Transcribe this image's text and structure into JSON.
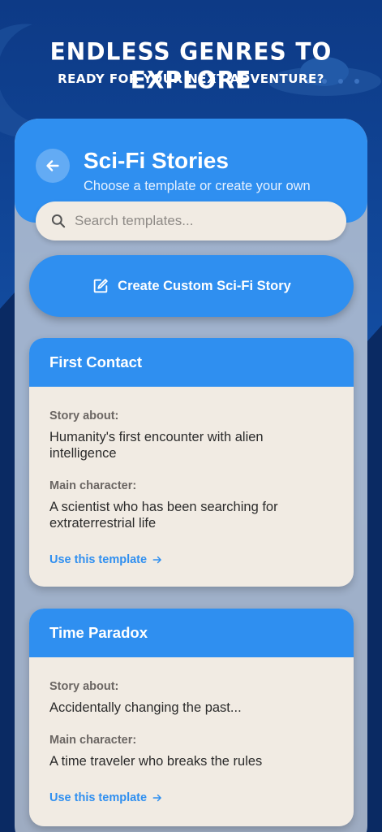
{
  "promo": {
    "headline": "Endless Genres to Explore",
    "subline": "Ready for your next adventure?"
  },
  "header": {
    "title": "Sci-Fi Stories",
    "subtitle": "Choose a template or create your own",
    "back_icon": "arrow-left-icon"
  },
  "search": {
    "placeholder": "Search templates...",
    "value": ""
  },
  "create_button": {
    "label": "Create Custom Sci-Fi Story",
    "icon": "edit-icon"
  },
  "templates": [
    {
      "title": "First Contact",
      "story_label": "Story about:",
      "story": "Humanity's first encounter with alien intelligence",
      "character_label": "Main character:",
      "character": "A scientist who has been searching for extraterrestrial life",
      "action": "Use this template"
    },
    {
      "title": "Time Paradox",
      "story_label": "Story about:",
      "story": "Accidentally changing the past...",
      "character_label": "Main character:",
      "character": "A time traveler who breaks the rules",
      "action": "Use this template"
    }
  ],
  "colors": {
    "background": "#0d3a86",
    "accent": "#2f8ff0",
    "card": "#f1ebe3"
  }
}
